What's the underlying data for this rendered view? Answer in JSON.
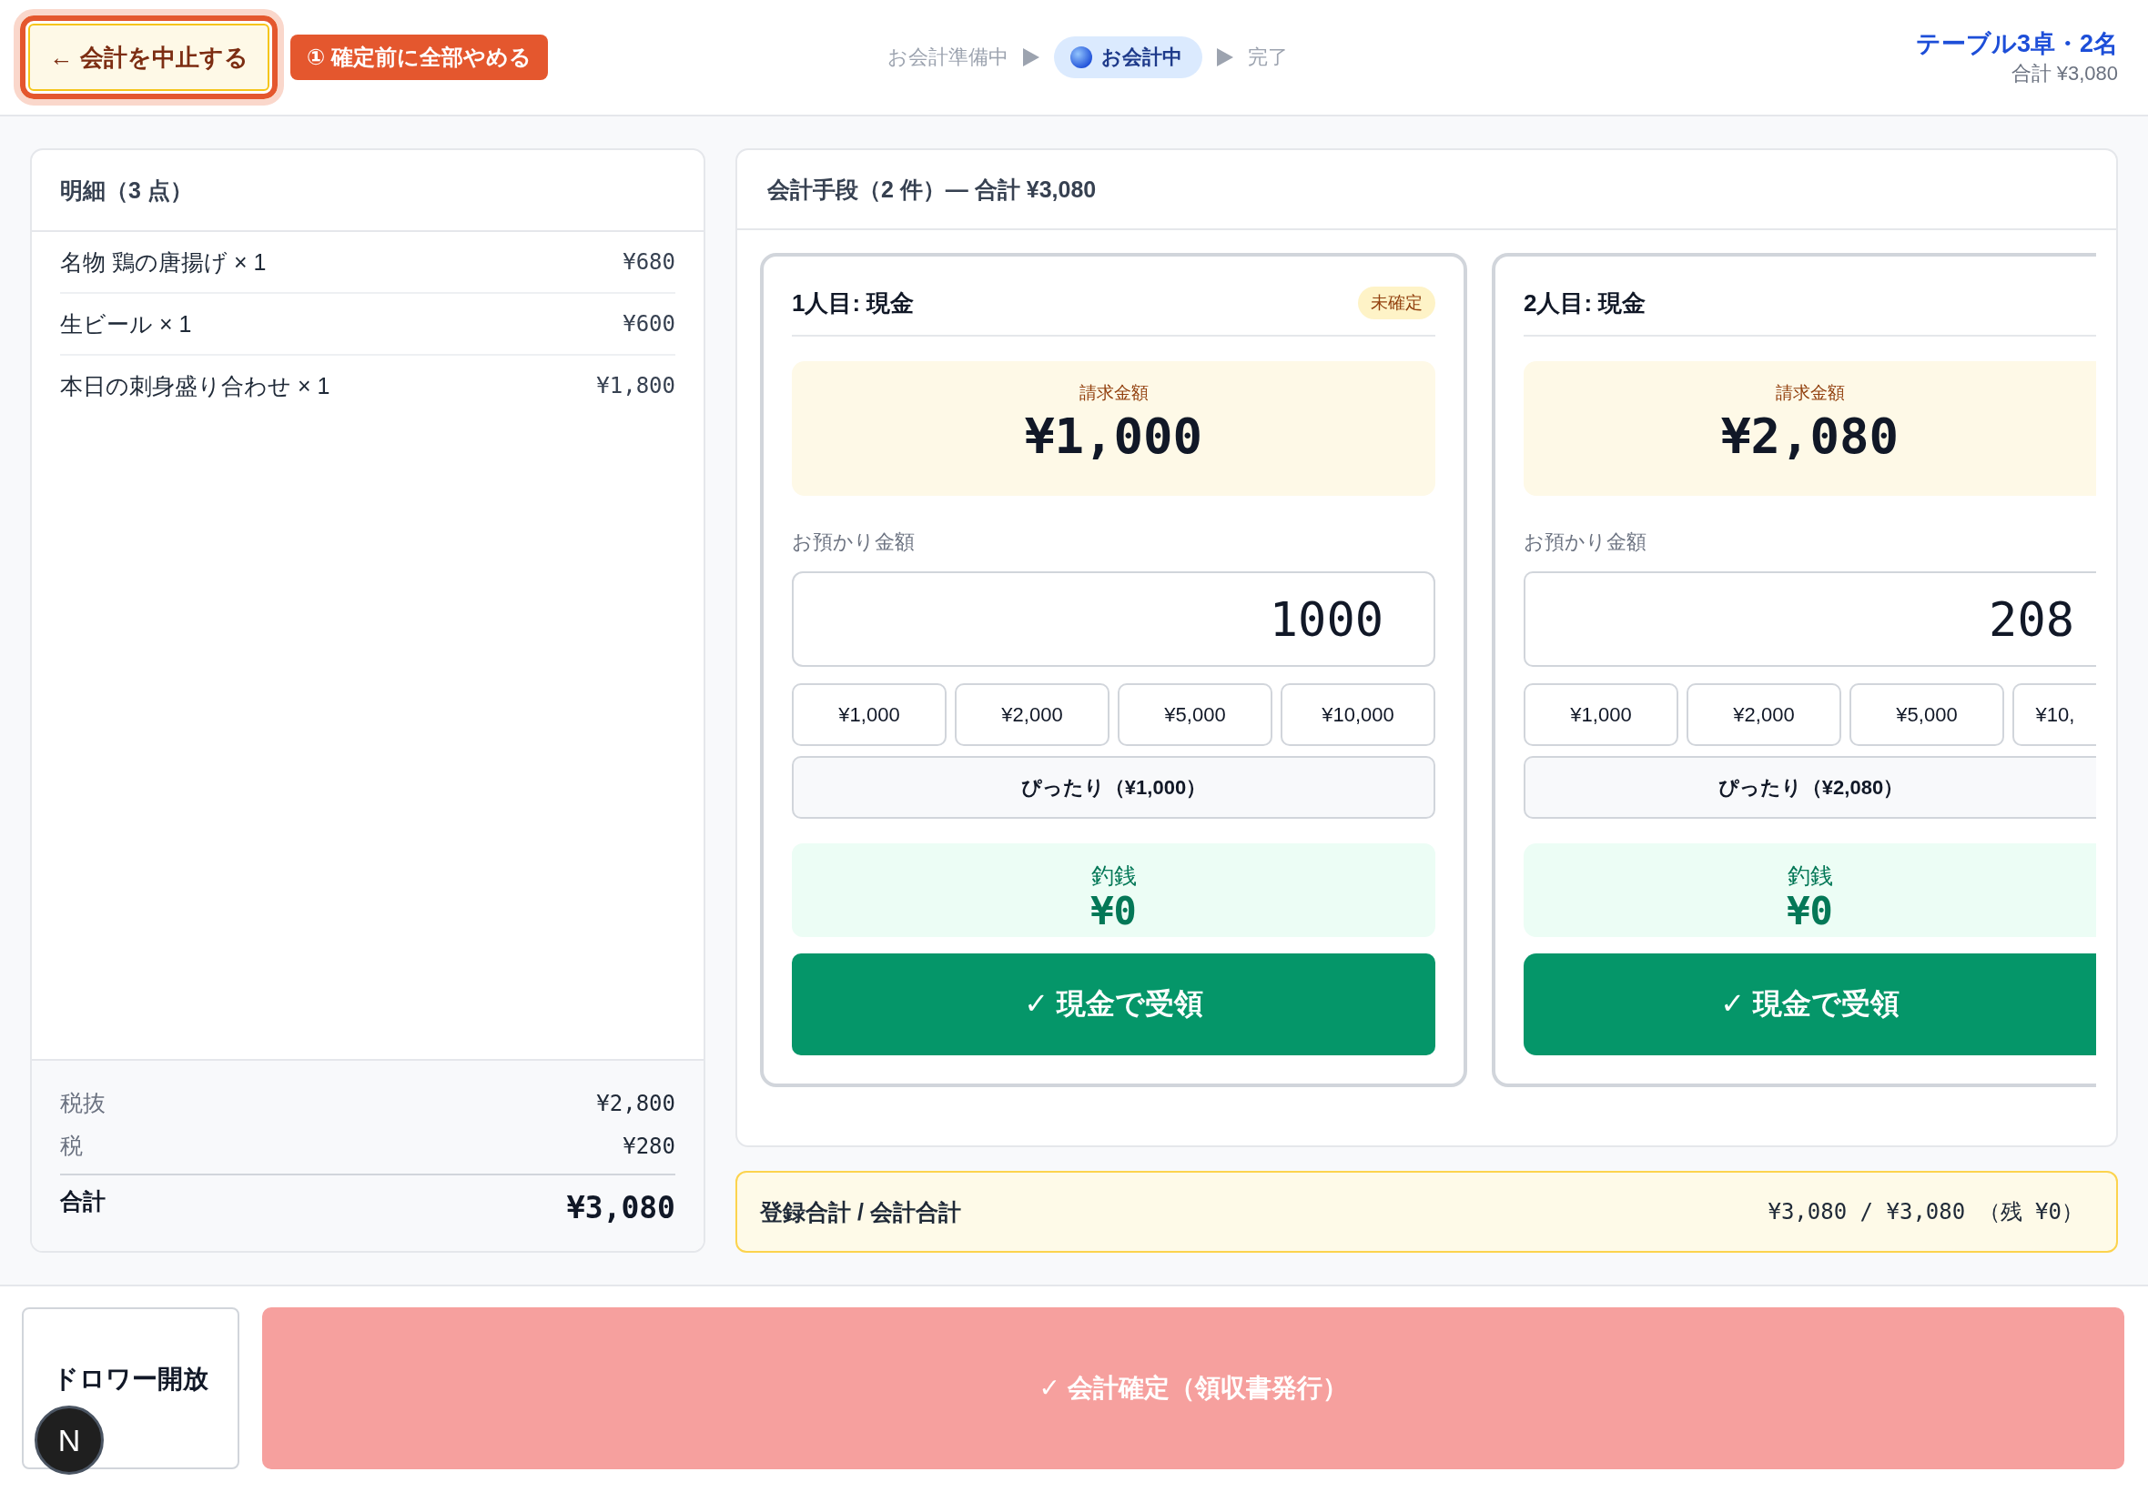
{
  "header": {
    "cancel_button": "← 会計を中止する",
    "hint_badge": "① 確定前に全部やめる",
    "steps": [
      {
        "label": "お会計準備中",
        "selected": false
      },
      {
        "label": "お会計中",
        "selected": true
      },
      {
        "label": "完了",
        "selected": false
      }
    ],
    "table": "テーブル3卓・2名",
    "total": "合計 ¥3,080"
  },
  "order": {
    "title": "明細（3 点）",
    "items": [
      {
        "name": "名物 鶏の唐揚げ × 1",
        "price": "¥680"
      },
      {
        "name": "生ビール × 1",
        "price": "¥600"
      },
      {
        "name": "本日の刺身盛り合わせ × 1",
        "price": "¥1,800"
      }
    ],
    "summary": [
      {
        "kind": "row",
        "label": "税抜",
        "value": "¥2,800"
      },
      {
        "kind": "row",
        "label": "税",
        "value": "¥280"
      },
      {
        "kind": "total",
        "label": "合計",
        "value": "¥3,080"
      }
    ]
  },
  "payments": {
    "title": "会計手段（2 件）— 合計 ¥3,080",
    "cards": [
      {
        "title": "1人目: 現金",
        "status": "未確定",
        "amount_label": "請求金額",
        "amount": "¥1,000",
        "tendered_label": "お預かり金額",
        "tendered": "1000",
        "quick_amounts": [
          "¥1,000",
          "¥2,000",
          "¥5,000",
          "¥10,000"
        ],
        "exact_button": "ぴったり（¥1,000）",
        "change_label": "釣銭",
        "change": "¥0",
        "receive_button": "✓ 現金で受領"
      },
      {
        "title": "2人目: 現金",
        "amount_label": "請求金額",
        "amount": "¥2,080",
        "tendered_label": "お預かり金額",
        "tendered": "208",
        "quick_amounts": [
          "¥1,000",
          "¥2,000",
          "¥5,000",
          "¥10,"
        ],
        "exact_button": "ぴったり（¥2,080）",
        "change_label": "釣銭",
        "change": "¥0",
        "receive_button": "✓ 現金で受領"
      }
    ]
  },
  "balance": {
    "label": "登録合計 / 会計合計",
    "value": "¥3,080 / ¥3,080 （残 ¥0）"
  },
  "footer": {
    "drawer_button": "ドロワー開放",
    "confirm_button": {
      "label": "✓ 会計確定（領収書発行）",
      "disabled": true
    }
  },
  "dev_tools_button": "N"
}
